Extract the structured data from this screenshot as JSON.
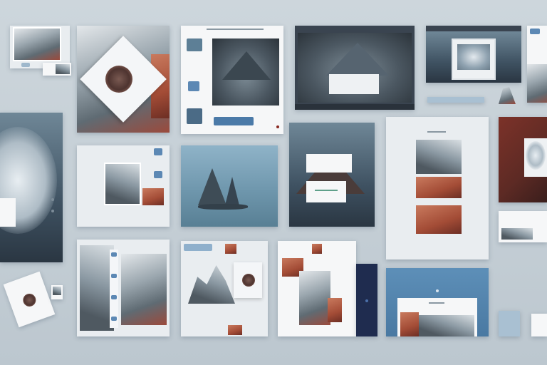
{
  "title": "",
  "palette": {
    "background": "#c8d1d8",
    "accent": "#4b7aa8",
    "rust": "#a34c36",
    "navy": "#1f2c4f"
  },
  "tiles": [
    {
      "name": "tile-rock-thumbnail"
    },
    {
      "name": "tile-seal-diamond"
    },
    {
      "name": "tile-mountain-viewer"
    },
    {
      "name": "tile-misty-mountain-dark"
    },
    {
      "name": "tile-framed-wave"
    },
    {
      "name": "tile-large-wave"
    },
    {
      "name": "tile-fragment-collage"
    },
    {
      "name": "tile-sea-stacks"
    },
    {
      "name": "tile-storm-mountain"
    },
    {
      "name": "tile-stacked-panels"
    },
    {
      "name": "tile-red-wave"
    },
    {
      "name": "tile-tall-strips"
    },
    {
      "name": "tile-mountain-seal"
    },
    {
      "name": "tile-rock-fragments"
    },
    {
      "name": "tile-blue-landscape"
    }
  ]
}
